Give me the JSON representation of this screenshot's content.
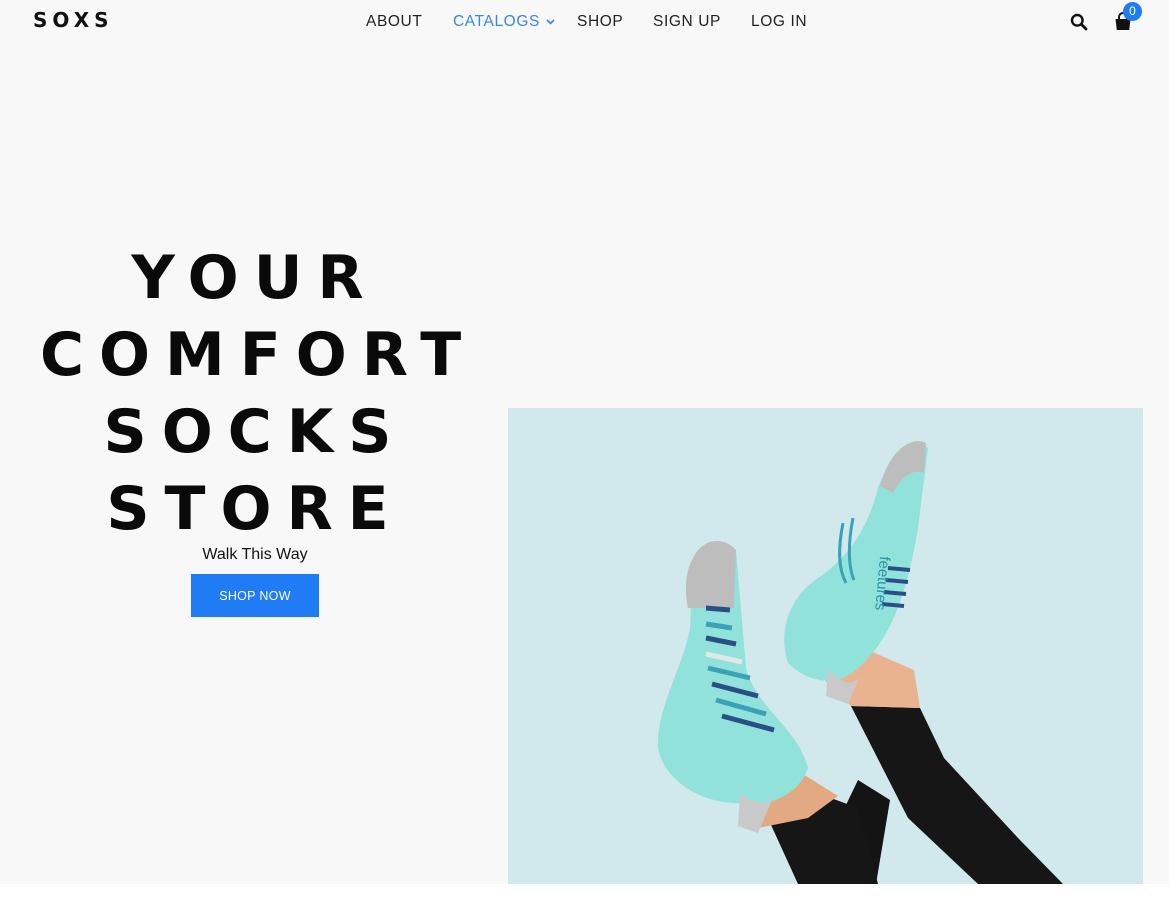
{
  "brand": {
    "logo_text": "SOXS"
  },
  "nav": {
    "items": [
      {
        "label": "ABOUT",
        "active": false,
        "has_dropdown": false
      },
      {
        "label": "CATALOGS",
        "active": true,
        "has_dropdown": true
      },
      {
        "label": "SHOP",
        "active": false,
        "has_dropdown": false
      },
      {
        "label": "SIGN UP",
        "active": false,
        "has_dropdown": false
      },
      {
        "label": "LOG IN",
        "active": false,
        "has_dropdown": false
      }
    ]
  },
  "header_icons": {
    "search_icon": "search-icon",
    "cart_icon": "shopping-bag-icon",
    "cart_count": "0"
  },
  "hero": {
    "title_lines": [
      "YOUR",
      "COMFORT",
      "SOCKS",
      "STORE"
    ],
    "subtitle": "Walk This Way",
    "cta_label": "SHOP NOW",
    "image": "socks-photo",
    "sock_brand_text": "feetures"
  },
  "colors": {
    "accent": "#1f7cf5",
    "nav_active": "#3a86e8",
    "page_bg": "#f8f8f8",
    "image_bg": "#d1e9ec",
    "sock_mint": "#92e2dc",
    "text_dark": "#0a0a0a"
  }
}
